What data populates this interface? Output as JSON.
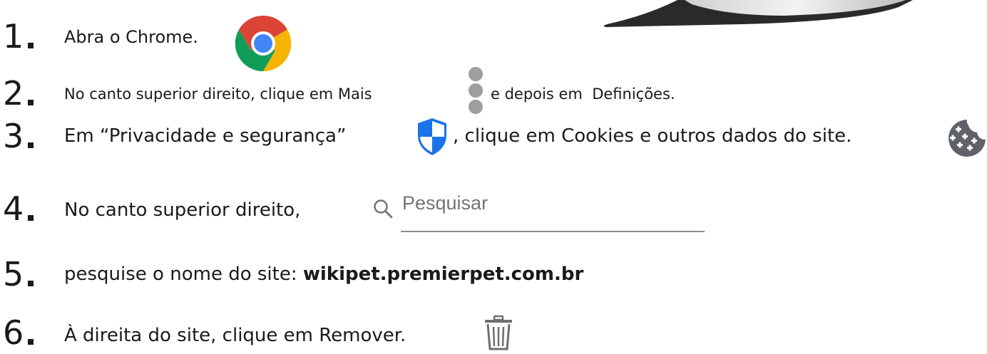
{
  "steps": [
    {
      "number": "1",
      "text": "Abra o Chrome."
    },
    {
      "number": "2",
      "text_before": "No canto superior direito, clique em Mais",
      "text_after": "e depois em  Definições."
    },
    {
      "number": "3",
      "text_before": "Em “Privacidade e segurança”",
      "text_after": ", clique em Cookies e outros dados do site."
    },
    {
      "number": "4",
      "text": "No canto superior direito,"
    },
    {
      "number": "5",
      "text_before": "pesquise o nome do site: ",
      "site": "wikipet.premierpet.com.br"
    },
    {
      "number": "6",
      "text": "À direita do site, clique em Remover."
    }
  ],
  "search": {
    "placeholder": "Pesquisar"
  },
  "icons": {
    "step1": "chrome-logo-icon",
    "step2": "more-vertical-icon",
    "step3_a": "shield-icon",
    "step3_b": "cookie-icon",
    "step4": "search-icon",
    "step6": "trash-icon"
  },
  "colors": {
    "chrome_red": "#DB4437",
    "chrome_yellow": "#F4B400",
    "chrome_green": "#0F9D58",
    "chrome_blue": "#4285F4",
    "shield_blue": "#1A73E8",
    "more_dots": "#9E9E9E",
    "cookie": "#5F6368",
    "trash": "#6F6F6F",
    "search_underline": "#8A8A8A"
  }
}
